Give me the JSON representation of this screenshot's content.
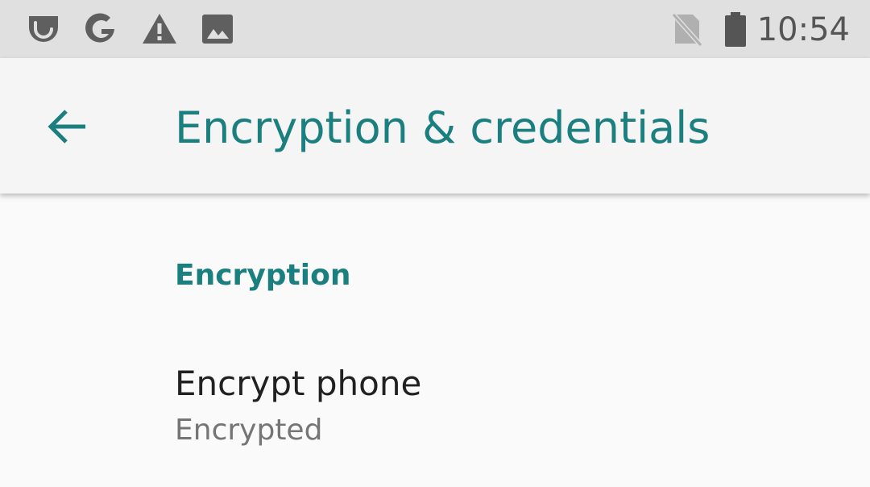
{
  "status_bar": {
    "time": "10:54",
    "left_icons": [
      "pocket-icon",
      "google-icon",
      "warning-icon",
      "image-icon"
    ],
    "right_icons": [
      "no-sim-icon",
      "battery-icon"
    ]
  },
  "app_bar": {
    "title": "Encryption & credentials",
    "back_icon": "arrow-back-icon",
    "accent_color": "#1b7f7f"
  },
  "content": {
    "section_header": "Encryption",
    "items": [
      {
        "title": "Encrypt phone",
        "summary": "Encrypted"
      }
    ]
  }
}
